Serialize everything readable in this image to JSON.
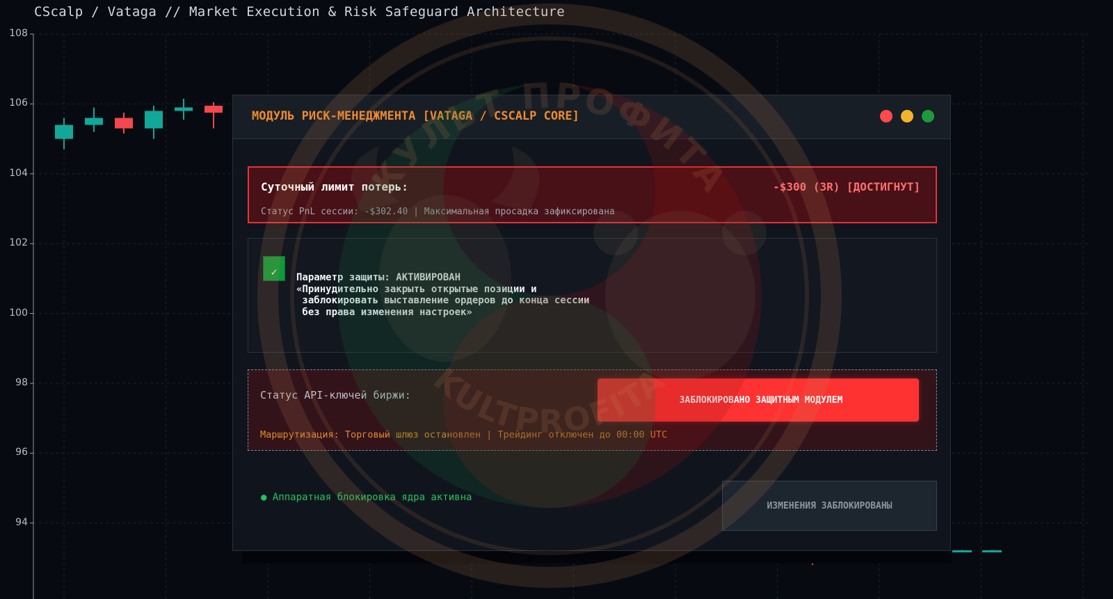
{
  "window": {
    "title": "CScalp / Vataga // Market Execution & Risk Safeguard Architecture"
  },
  "watermark": {
    "top_text": "КУЛЬТ ПРОФИТА",
    "bottom_text": "KULTPROFITA",
    "emblem": "bull-and-bear-emblem"
  },
  "chart_data": {
    "type": "candlestick",
    "ylim": [
      92,
      108
    ],
    "y_ticks": [
      108,
      106,
      104,
      102,
      100,
      98,
      96,
      94
    ],
    "grid": true,
    "colors": {
      "up": "#11a89a",
      "down": "#f4474e"
    },
    "candles": [
      {
        "open": 105.0,
        "high": 105.6,
        "low": 104.7,
        "close": 105.4
      },
      {
        "open": 105.4,
        "high": 105.9,
        "low": 105.2,
        "close": 105.6
      },
      {
        "open": 105.6,
        "high": 105.75,
        "low": 105.15,
        "close": 105.3
      },
      {
        "open": 105.3,
        "high": 105.95,
        "low": 105.0,
        "close": 105.8
      },
      {
        "open": 105.8,
        "high": 106.15,
        "low": 105.55,
        "close": 105.9
      },
      {
        "open": 105.95,
        "high": 106.05,
        "low": 105.3,
        "close": 105.75
      },
      {
        "open": 93.5,
        "high": 93.6,
        "low": 92.8,
        "close": 93.2
      },
      {
        "open": 93.22,
        "high": 93.24,
        "low": 93.18,
        "close": 93.2
      },
      {
        "open": 93.2,
        "high": 93.22,
        "low": 93.18,
        "close": 93.2
      },
      {
        "open": 93.2,
        "high": 93.22,
        "low": 93.18,
        "close": 93.2
      },
      {
        "open": 93.2,
        "high": 93.22,
        "low": 93.18,
        "close": 93.2
      },
      {
        "open": 93.2,
        "high": 93.23,
        "low": 93.18,
        "close": 93.22
      },
      {
        "open": 93.2,
        "high": 93.23,
        "low": 93.18,
        "close": 93.22
      }
    ]
  },
  "modal": {
    "title": "МОДУЛЬ РИСК-МЕНЕДЖМЕНТА [VATAGA / CSCALP CORE]",
    "window_controls": [
      "red",
      "yellow",
      "green"
    ],
    "limit": {
      "label": "Суточный лимит потерь:",
      "value": "-$300 (3R)  [ДОСТИГНУТ]",
      "sub": "Статус PnL сессии: -$302.40  |  Максимальная просадка зафиксирована"
    },
    "protection": {
      "checked": true,
      "check_glyph": "✓",
      "text": "Параметр защиты: АКТИВИРОВАН\n«Принудительно закрыть открытые позиции и\n заблокировать выставление ордеров до конца сессии\n без права изменения настроек»"
    },
    "api": {
      "label": "Статус API-ключей биржи:",
      "button_icon": "",
      "button_label": "ЗАБЛОКИРОВАНО ЗАЩИТНЫМ МОДУЛЕМ",
      "routing": "Маршрутизация: Торговый шлюз остановлен | Трейдинг отключен до 00:00 UTC"
    },
    "footer": {
      "status": "● Аппаратная блокировка ядра активна",
      "locked_button": "ИЗМЕНЕНИЯ ЗАБЛОКИРОВАНЫ"
    }
  }
}
